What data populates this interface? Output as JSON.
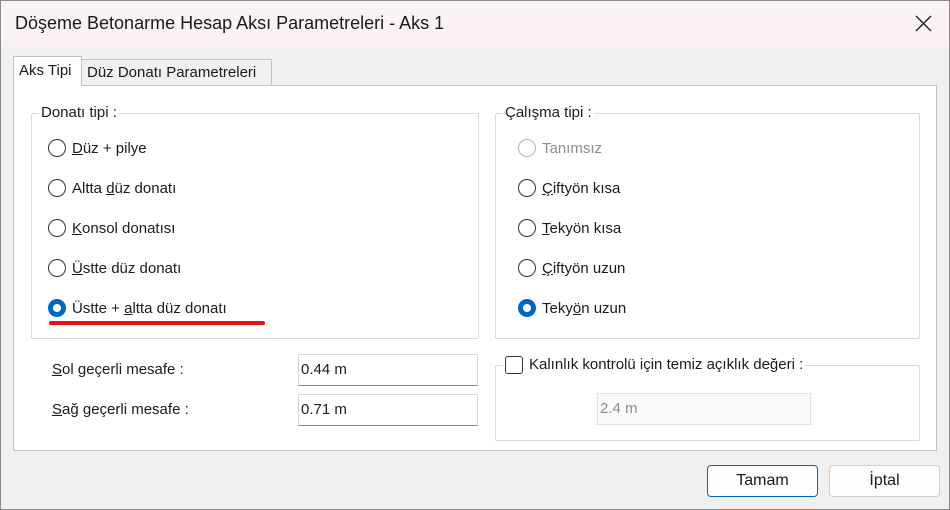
{
  "window": {
    "title": "Döşeme Betonarme Hesap Aksı Parametreleri - Aks 1"
  },
  "icons": {
    "close": "close-icon"
  },
  "tabs": [
    {
      "label": "Aks Tipi",
      "active": true
    },
    {
      "label": "Düz Donatı Parametreleri",
      "active": false
    }
  ],
  "donati_tipi": {
    "label": "Donatı tipi :",
    "options": [
      {
        "pre": "",
        "ul": "D",
        "post": "üz + pilye",
        "checked": false
      },
      {
        "pre": "Altta ",
        "ul": "d",
        "post": "üz donatı",
        "checked": false
      },
      {
        "pre": "",
        "ul": "K",
        "post": "onsol donatısı",
        "checked": false
      },
      {
        "pre": "",
        "ul": "Ü",
        "post": "stte düz donatı",
        "checked": false
      },
      {
        "pre": "Üstte + ",
        "ul": "a",
        "post": "ltta düz donatı",
        "checked": true
      }
    ]
  },
  "calisma_tipi": {
    "label": "Çalışma tipi :",
    "options": [
      {
        "pre": "",
        "ul": "",
        "post": "Tanımsız",
        "checked": false,
        "disabled": true
      },
      {
        "pre": "",
        "ul": "Ç",
        "post": "iftyön kısa",
        "checked": false,
        "disabled": false
      },
      {
        "pre": "",
        "ul": "T",
        "post": "ekyön kısa",
        "checked": false,
        "disabled": false
      },
      {
        "pre": "",
        "ul": "Ç",
        "post": "iftyön uzun",
        "checked": false,
        "disabled": false
      },
      {
        "pre": "Teky",
        "ul": "ö",
        "post": "n uzun",
        "checked": true,
        "disabled": false
      }
    ]
  },
  "fields": {
    "sol": {
      "ul": "S",
      "rest": "ol geçerli mesafe :",
      "value": "0.44 m"
    },
    "sag": {
      "ul": "S",
      "rest": "ağ geçerli mesafe :",
      "value": "0.71 m"
    }
  },
  "kalinlik": {
    "label": "Kalınlık kontrolü için temiz açıklık değeri :",
    "checked": false,
    "value": "2.4 m"
  },
  "buttons": {
    "ok": "Tamam",
    "cancel": "İptal"
  },
  "colors": {
    "accent": "#0067c0",
    "highlight": "#e0121b"
  }
}
